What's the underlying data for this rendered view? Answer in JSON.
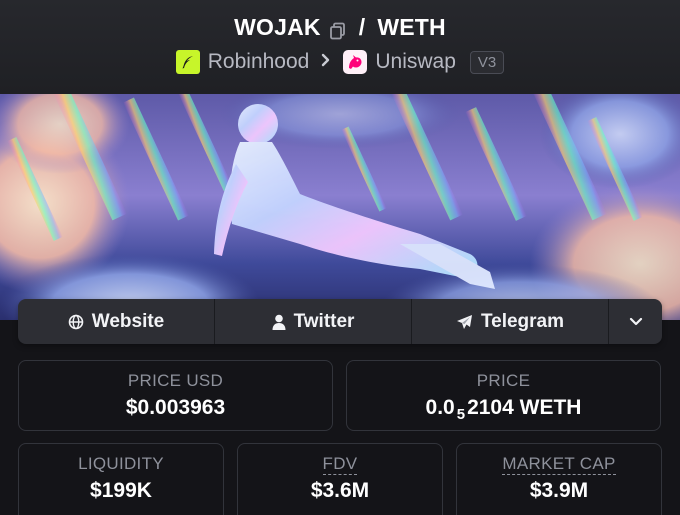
{
  "header": {
    "base_token": "WOJAK",
    "separator": "/",
    "quote_token": "WETH",
    "chain": "Robinhood",
    "dex": "Uniswap",
    "version": "V3",
    "icons": [
      "copy-icon",
      "robinhood-feather-icon",
      "chevron-right-icon",
      "uniswap-unicorn-icon"
    ]
  },
  "banner": {
    "description_icon": "banner-image"
  },
  "links": {
    "website": "Website",
    "twitter": "Twitter",
    "telegram": "Telegram",
    "icons": [
      "globe-icon",
      "user-icon",
      "telegram-plane-icon",
      "chevron-down-icon"
    ]
  },
  "stats": {
    "price_usd_label": "PRICE USD",
    "price_usd_value": "$0.003963",
    "price_label": "PRICE",
    "price_prefix": "0.0",
    "price_zero_count": "5",
    "price_suffix": "2104 WETH",
    "liquidity_label": "LIQUIDITY",
    "liquidity_value": "$199K",
    "fdv_label": "FDV",
    "fdv_value": "$3.6M",
    "mcap_label": "MARKET CAP",
    "mcap_value": "$3.9M"
  },
  "colors": {
    "background": "#141418",
    "header_bg": "#232428",
    "robinhood_green": "#c7f52a",
    "uniswap_pink": "#ff007a"
  }
}
